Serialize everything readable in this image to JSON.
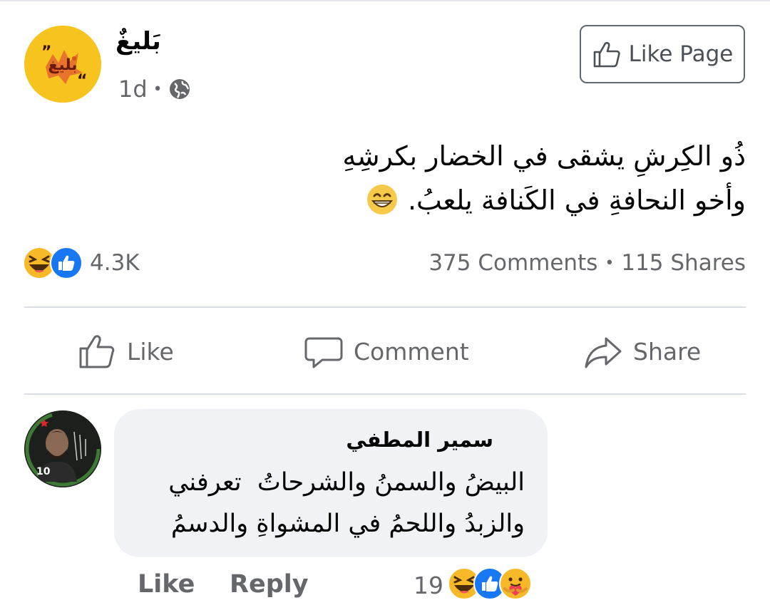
{
  "post": {
    "page_name": "بَليغٌ",
    "time": "1d",
    "privacy_icon": "globe-icon",
    "like_page_label": "Like Page",
    "text_line1": "ذُو الكِرشِ يشقى في الخضار بكرشِهِ",
    "text_line2": "وأخو النحافةِ في الكَنافة يلعبُ.",
    "text_emoji": "grinning-face-emoji"
  },
  "stats": {
    "reaction_count": "4.3K",
    "reaction_icons": [
      "haha-icon",
      "like-icon"
    ],
    "comments": "375 Comments",
    "shares": "115 Shares"
  },
  "actions": {
    "like": "Like",
    "comment": "Comment",
    "share": "Share"
  },
  "comment": {
    "author": "سمير المطفي",
    "line1": "البيضُ والسمنُ والشرحاتُ  تعرفني",
    "line2": "والزبدُ واللحمُ في المشواةِ والدسمُ",
    "avatar_badge": "10",
    "like_label": "Like",
    "reply_label": "Reply",
    "reaction_count": "19",
    "reaction_icons": [
      "haha-icon",
      "like-icon",
      "care-icon"
    ]
  },
  "colors": {
    "secondary_text": "#65676b",
    "bubble_bg": "#f0f2f5",
    "like_blue": "#1877f2",
    "reaction_yellow": "#f7b928"
  }
}
